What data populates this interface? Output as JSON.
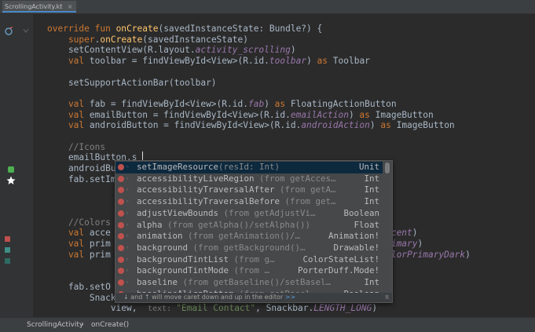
{
  "tab": {
    "label": "ScrollingActivity.kt",
    "close": "×"
  },
  "code": [
    [
      [
        "kw",
        "override fun "
      ],
      [
        "fn",
        "onCreate"
      ],
      [
        "",
        "(savedInstanceState: Bundle?) {"
      ]
    ],
    [
      [
        "kw",
        "    super"
      ],
      [
        "",
        "."
      ],
      [
        "fn",
        "onCreate"
      ],
      [
        "",
        "(savedInstanceState)"
      ]
    ],
    [
      [
        "",
        "    setContentView(R.layout."
      ],
      [
        "it",
        "activity_scrolling"
      ],
      [
        "",
        ")"
      ]
    ],
    [
      [
        "kw",
        "    val "
      ],
      [
        "",
        "toolbar = findViewById<View>(R.id."
      ],
      [
        "it",
        "toolbar"
      ],
      [
        "",
        ") "
      ],
      [
        "kw",
        "as "
      ],
      [
        "",
        "Toolbar"
      ]
    ],
    [],
    [
      [
        "",
        "    setSupportActionBar(toolbar)"
      ]
    ],
    [],
    [
      [
        "kw",
        "    val "
      ],
      [
        "",
        "fab = findViewById<View>(R.id."
      ],
      [
        "it",
        "fab"
      ],
      [
        "",
        ") "
      ],
      [
        "kw",
        "as "
      ],
      [
        "",
        "FloatingActionButton"
      ]
    ],
    [
      [
        "kw",
        "    val "
      ],
      [
        "",
        "emailButton = findViewById<View>(R.id."
      ],
      [
        "it",
        "emailAction"
      ],
      [
        "",
        ") "
      ],
      [
        "kw",
        "as "
      ],
      [
        "",
        "ImageButton"
      ]
    ],
    [
      [
        "kw",
        "    val "
      ],
      [
        "",
        "androidButton = findViewById<View>(R.id."
      ],
      [
        "it",
        "androidAction"
      ],
      [
        "",
        ") "
      ],
      [
        "kw",
        "as "
      ],
      [
        "",
        "ImageButton"
      ]
    ],
    [],
    [
      [
        "cm",
        "    //Icons"
      ]
    ],
    [
      [
        "",
        "    emailButton.s"
      ]
    ],
    [
      [
        "",
        "    androidBu"
      ]
    ],
    [
      [
        "",
        "    fab.setIm"
      ]
    ],
    [],
    [],
    [],
    [
      [
        "cm",
        "    //Colors"
      ]
    ],
    [
      [
        "kw",
        "    val "
      ],
      [
        "",
        "acce"
      ],
      [
        "",
        "                                               "
      ],
      [
        "it",
        "olorAccent"
      ],
      [
        "",
        ")"
      ]
    ],
    [
      [
        "kw",
        "    val "
      ],
      [
        "",
        "prim"
      ],
      [
        "",
        "                                               "
      ],
      [
        "it",
        "olorPrimary"
      ],
      [
        "",
        ")"
      ]
    ],
    [
      [
        "kw",
        "    val "
      ],
      [
        "",
        "prim"
      ],
      [
        "",
        "                                               lor."
      ],
      [
        "it",
        "colorPrimaryDark"
      ],
      [
        "",
        ")"
      ]
    ],
    [],
    [],
    [
      [
        "",
        "    fab.setO"
      ]
    ],
    [
      [
        "",
        "        Snackbar.make("
      ]
    ],
    [
      [
        "",
        "            view,  "
      ],
      [
        "hint",
        "text: "
      ],
      [
        "str",
        "\"Email Contact\""
      ],
      [
        "",
        ", Snackbar."
      ],
      [
        "it",
        "LENGTH_LONG"
      ],
      [
        "",
        ")"
      ]
    ]
  ],
  "completion": {
    "items": [
      {
        "name": "setImageResource",
        "extra": "(resId: Int)",
        "type": "Unit"
      },
      {
        "name": "accessibilityLiveRegion",
        "extra": " (from getAcces…",
        "type": "Int"
      },
      {
        "name": "accessibilityTraversalAfter",
        "extra": " (from getA…",
        "type": "Int"
      },
      {
        "name": "accessibilityTraversalBefore",
        "extra": " (from get…",
        "type": "Int"
      },
      {
        "name": "adjustViewBounds",
        "extra": " (from getAdjustVi…",
        "type": "Boolean"
      },
      {
        "name": "alpha",
        "extra": " (from getAlpha()/setAlpha())",
        "type": "Float"
      },
      {
        "name": "animation",
        "extra": " (from getAnimation()/…",
        "type": "Animation!"
      },
      {
        "name": "background",
        "extra": " (from getBackground()…",
        "type": "Drawable!"
      },
      {
        "name": "backgroundTintList",
        "extra": " (from g…",
        "type": "ColorStateList!"
      },
      {
        "name": "backgroundTintMode",
        "extra": " (from …",
        "type": "PorterDuff.Mode!"
      },
      {
        "name": "baseline",
        "extra": " (from getBaseline()/setBasel…",
        "type": "Int"
      },
      {
        "name": "baselineAlignBottom",
        "extra": " (from getBasel…",
        "type": "Boolean"
      }
    ],
    "footer": "↓ and ↑ will move caret down and up in the editor",
    "footer_link": ">>",
    "footer_pi": "π"
  },
  "status": {
    "class": "ScrollingActivity",
    "method": "onCreate()"
  },
  "colors": {
    "red": "#c0504d",
    "teal": "#3f8f87",
    "green": "#4caf50"
  }
}
